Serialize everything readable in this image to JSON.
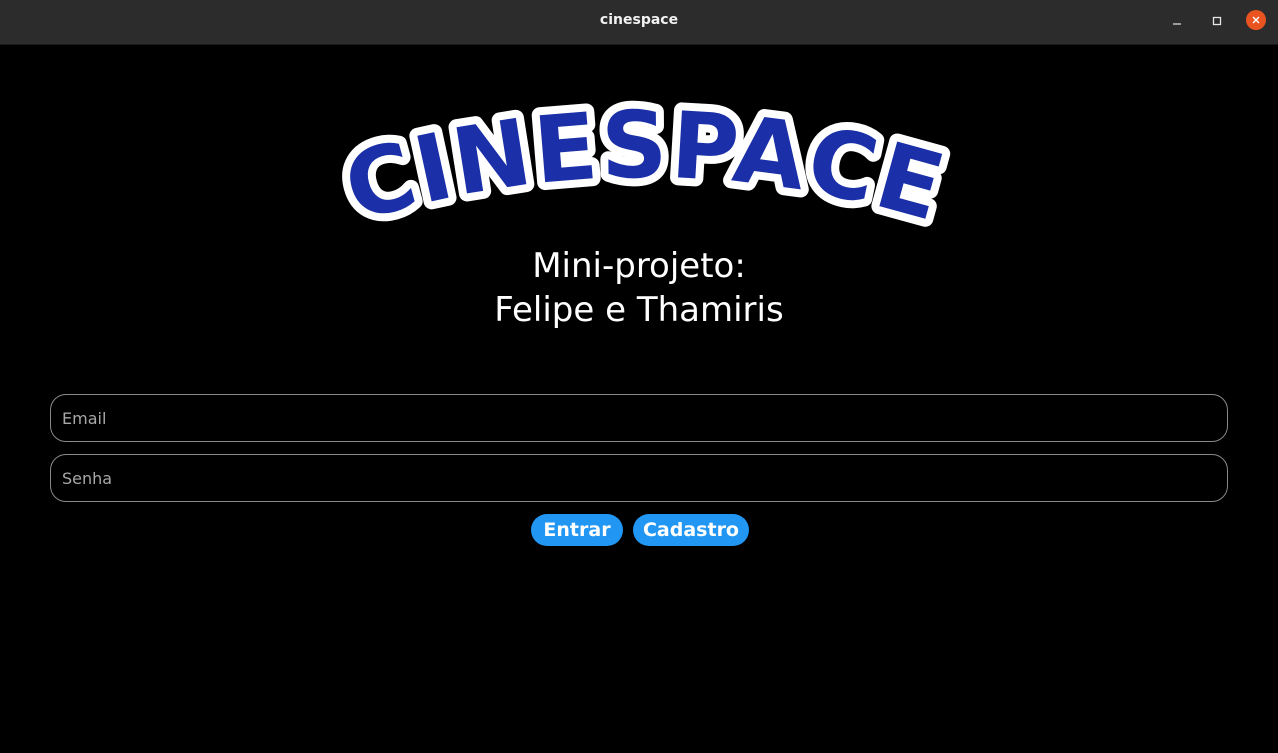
{
  "window": {
    "title": "cinespace",
    "controls": {
      "minimize_icon": "minimize-icon",
      "maximize_icon": "maximize-icon",
      "close_icon": "close-icon"
    },
    "close_color": "#e95420"
  },
  "logo": {
    "text": "CINESPACE",
    "fill_color": "#1a2fa8",
    "outline_color": "#ffffff"
  },
  "subtitle": {
    "line1": "Mini-projeto:",
    "line2": "Felipe e Thamiris"
  },
  "form": {
    "email": {
      "value": "",
      "placeholder": "Email"
    },
    "senha": {
      "value": "",
      "placeholder": "Senha"
    }
  },
  "buttons": {
    "entrar": "Entrar",
    "cadastro": "Cadastro"
  },
  "colors": {
    "background": "#000000",
    "titlebar": "#2c2c2c",
    "button": "#2196f3"
  }
}
